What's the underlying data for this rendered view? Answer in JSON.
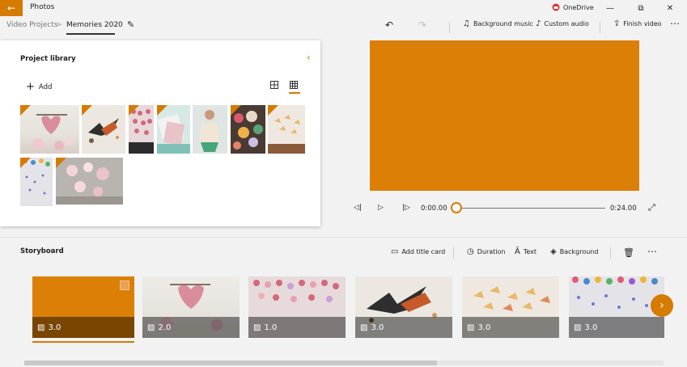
{
  "window": {
    "app_title": "Photos",
    "onedrive_label": "OneDrive",
    "minimize": "—",
    "maximize": "⧉",
    "close": "✕"
  },
  "breadcrumb": {
    "parent": "Video Projects",
    "separator": ">",
    "current": "Memories 2020"
  },
  "toolbar": {
    "undo": "↶",
    "redo": "↷",
    "background_music": "Background music",
    "custom_audio": "Custom audio",
    "finish_video": "Finish video",
    "more": "⋯"
  },
  "library": {
    "title": "Project library",
    "add_label": "Add",
    "collapse": "‹"
  },
  "player": {
    "current_time": "0:00.00",
    "total_time": "0:24.00",
    "progress": 0
  },
  "storyboard": {
    "title": "Storyboard",
    "add_title_card": "Add title card",
    "duration": "Duration",
    "text": "Text",
    "background": "Background",
    "more": "⋯",
    "clips": [
      {
        "duration": "3.0",
        "kind": "title-card"
      },
      {
        "duration": "2.0",
        "kind": "heart-mobile"
      },
      {
        "duration": "1.0",
        "kind": "paper-hearts"
      },
      {
        "duration": "3.0",
        "kind": "ink-birds"
      },
      {
        "duration": "3.0",
        "kind": "paper-butterflies"
      },
      {
        "duration": "3.0",
        "kind": "rain-drops"
      }
    ]
  },
  "colors": {
    "accent": "#d47b00",
    "preview": "#dc7f07"
  }
}
